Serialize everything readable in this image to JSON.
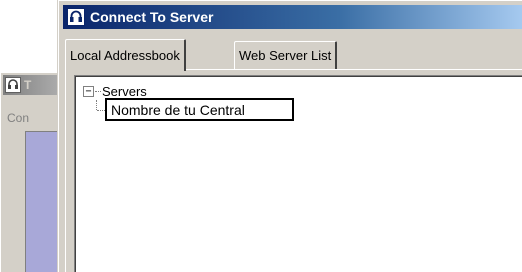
{
  "background_window": {
    "title_fragment": "T",
    "label_fragment": "Con"
  },
  "window": {
    "title": "Connect To Server",
    "icon": "headset-icon"
  },
  "tabs": [
    {
      "label": "Local Addressbook",
      "active": true
    },
    {
      "label": "Web Server List",
      "active": false
    }
  ],
  "tree": {
    "root": {
      "label": "Servers",
      "expander": "−",
      "expanded": true
    },
    "children": [
      {
        "label": "Nombre de tu Central",
        "selected": true
      }
    ]
  },
  "colors": {
    "title_active_start": "#0a246a",
    "title_active_end": "#a6caf0",
    "window_face": "#d4d0c8",
    "bg_panel": "#a8a8d8"
  }
}
